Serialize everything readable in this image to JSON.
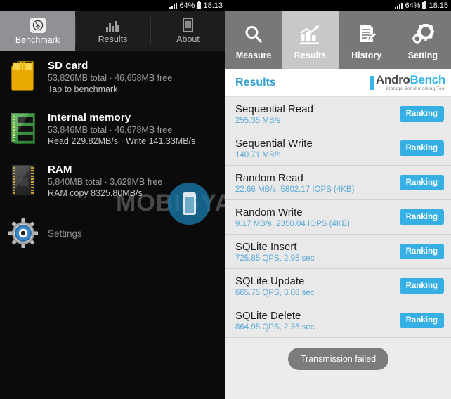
{
  "left_screen": {
    "statusbar": {
      "signal_icon": "signal-bars-icon",
      "battery_percent": "64%",
      "battery_icon": "battery-icon",
      "time": "18:13"
    },
    "tabs": [
      {
        "label": "Benchmark",
        "icon": "gauge-icon",
        "active": true
      },
      {
        "label": "Results",
        "icon": "bar-chart-icon",
        "active": false
      },
      {
        "label": "About",
        "icon": "phone-icon",
        "active": false
      }
    ],
    "items": [
      {
        "icon": "sd-card-icon",
        "title": "SD card",
        "capacity": "53,826MB total · 46,658MB free",
        "detail": "Tap to benchmark"
      },
      {
        "icon": "internal-memory-icon",
        "title": "Internal memory",
        "capacity": "53,846MB total · 46,678MB free",
        "detail": "Read 229.82MB/s · Write 141.33MB/s"
      },
      {
        "icon": "ram-chip-icon",
        "title": "RAM",
        "capacity": "5,840MB total · 3,629MB free",
        "detail": "RAM copy 8325.80MB/s"
      }
    ],
    "settings": {
      "label": "Settings",
      "icon": "gear-icon"
    },
    "watermark": {
      "text": "MOBIGYAAN",
      "icon": "mobigyaan-logo-icon"
    }
  },
  "right_screen": {
    "statusbar": {
      "signal_icon": "signal-bars-icon",
      "battery_percent": "64%",
      "battery_icon": "battery-icon",
      "time": "18:15"
    },
    "tabs": [
      {
        "label": "Measure",
        "icon": "magnifier-icon",
        "active": false
      },
      {
        "label": "Results",
        "icon": "chart-growth-icon",
        "active": true
      },
      {
        "label": "History",
        "icon": "document-pen-icon",
        "active": false
      },
      {
        "label": "Setting",
        "icon": "gears-icon",
        "active": false
      }
    ],
    "header": {
      "title": "Results",
      "logo_main_a": "Andro",
      "logo_main_b": "Bench",
      "logo_sub": "Storage Benchmarking Tool"
    },
    "results": [
      {
        "title": "Sequential Read",
        "value": "255.35 MB/s",
        "action": "Ranking"
      },
      {
        "title": "Sequential Write",
        "value": "140.71 MB/s",
        "action": "Ranking"
      },
      {
        "title": "Random Read",
        "value": "22.66 MB/s, 5802.17 IOPS (4KB)",
        "action": "Ranking"
      },
      {
        "title": "Random Write",
        "value": "9.17 MB/s, 2350.04 IOPS (4KB)",
        "action": "Ranking"
      },
      {
        "title": "SQLite Insert",
        "value": "725.85 QPS, 2.95 sec",
        "action": "Ranking"
      },
      {
        "title": "SQLite Update",
        "value": "665.75 QPS, 3.08 sec",
        "action": "Ranking"
      },
      {
        "title": "SQLite Delete",
        "value": "864.95 QPS, 2.36 sec",
        "action": "Ranking"
      }
    ],
    "toast": "Transmission failed"
  },
  "colors": {
    "accent_blue": "#36b0e4",
    "results_title": "#2f9fd0",
    "value_blue": "#5aa9d6",
    "dark_bg": "#0b0b0b",
    "light_bg": "#ececec",
    "tab_gray": "#787878"
  }
}
